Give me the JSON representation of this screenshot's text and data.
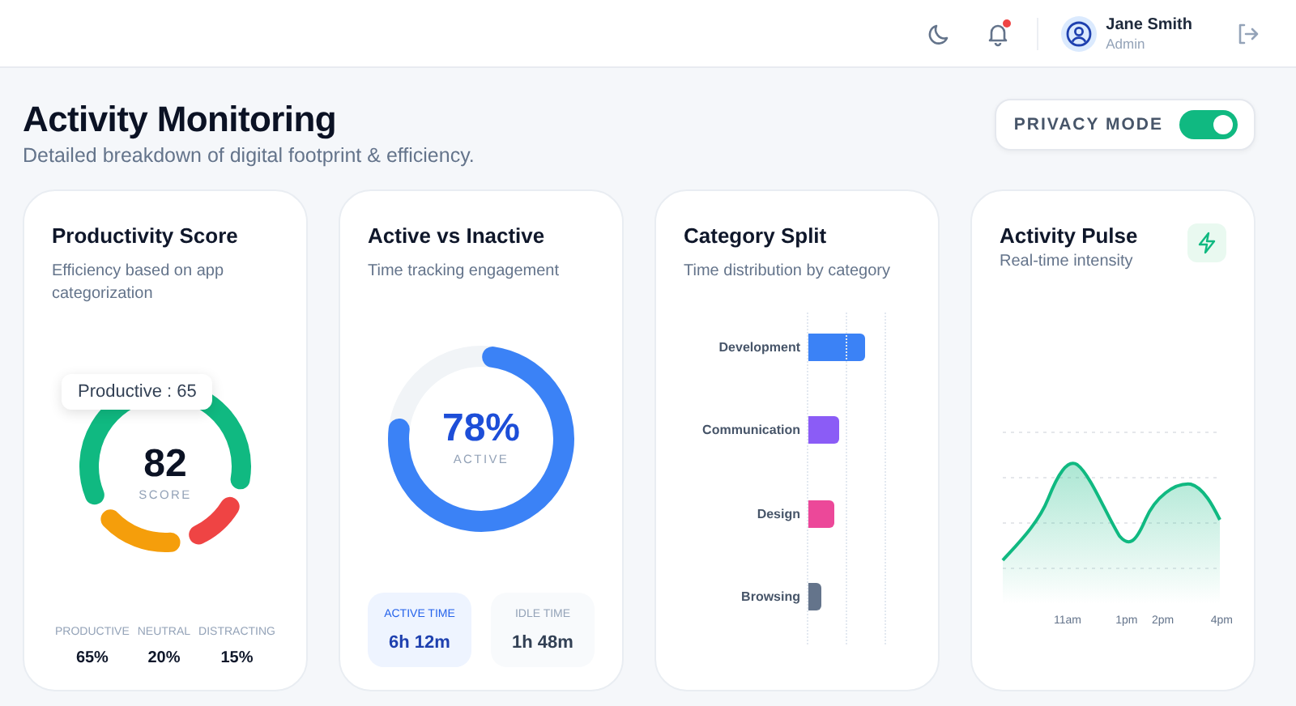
{
  "header": {
    "notification_unread": true,
    "user": {
      "name": "Jane Smith",
      "role": "Admin"
    }
  },
  "page": {
    "title": "Activity Monitoring",
    "subtitle": "Detailed breakdown of digital footprint & efficiency."
  },
  "privacy_mode": {
    "label": "PRIVACY MODE",
    "on": true
  },
  "cards": [
    {
      "kind": "score",
      "title": "Productivity Score",
      "subtitle": "Efficiency based on app categorization",
      "score": "82",
      "score_label": "SCORE",
      "tooltip": "Productive : 65",
      "segments": [
        {
          "label": "PRODUCTIVE",
          "value": "65%",
          "color": "#10b981"
        },
        {
          "label": "NEUTRAL",
          "value": "20%",
          "color": "#f59e0b"
        },
        {
          "label": "DISTRACTING",
          "value": "15%",
          "color": "#ef4444"
        }
      ]
    },
    {
      "kind": "ring",
      "title": "Active vs Inactive",
      "subtitle": "Time tracking engagement",
      "value": "78%",
      "value_label": "ACTIVE",
      "stats": [
        {
          "label": "ACTIVE TIME",
          "value": "6h 12m",
          "selected": true
        },
        {
          "label": "IDLE TIME",
          "value": "1h 48m",
          "selected": false
        }
      ]
    },
    {
      "kind": "bars",
      "title": "Category Split",
      "subtitle": "Time distribution by category",
      "bars": [
        {
          "label": "Development",
          "color": "#3b82f6"
        },
        {
          "label": "Communication",
          "color": "#8b5cf6"
        },
        {
          "label": "Design",
          "color": "#ec4899"
        },
        {
          "label": "Browsing",
          "color": "#64748b"
        }
      ]
    },
    {
      "kind": "pulse",
      "title": "Activity Pulse",
      "subtitle": "Real-time intensity",
      "x_labels": [
        "11am",
        "1pm",
        "2pm",
        "4pm"
      ]
    }
  ]
}
